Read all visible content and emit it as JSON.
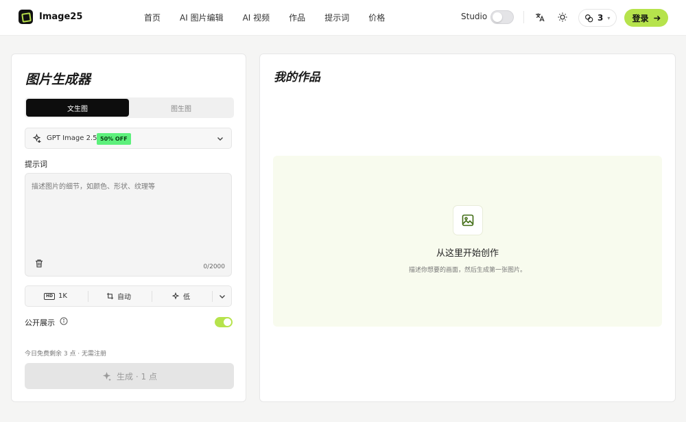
{
  "header": {
    "brand": "Image25",
    "nav": [
      "首页",
      "AI 图片编辑",
      "AI 视频",
      "作品",
      "提示词",
      "价格"
    ],
    "studio_label": "Studio",
    "credits": "3",
    "login_label": "登录"
  },
  "generator": {
    "title": "图片生成器",
    "tabs": [
      "文生图",
      "图生图"
    ],
    "model": {
      "name": "GPT Image 2.5",
      "badge": "50% OFF"
    },
    "prompt_label": "提示词",
    "prompt_placeholder": "描述图片的细节，如颜色、形状、纹理等",
    "prompt_value": "",
    "counter": "0/2000",
    "options": {
      "hd_badge": "HD",
      "resolution": "1K",
      "ratio": "自动",
      "quality": "低"
    },
    "public_label": "公开展示",
    "public_enabled": true,
    "free_note": "今日免费剩余 3 点 · 无需注册",
    "generate_label": "生成 · 1 点"
  },
  "works": {
    "title": "我的作品",
    "empty_title": "从这里开始创作",
    "empty_desc": "描述你想要的画面，然后生成第一张图片。"
  },
  "colors": {
    "accent": "#b6e34c",
    "badge_green": "#5df07c",
    "empty_bg": "#f8fbee",
    "icon_green": "#3f6b12"
  }
}
